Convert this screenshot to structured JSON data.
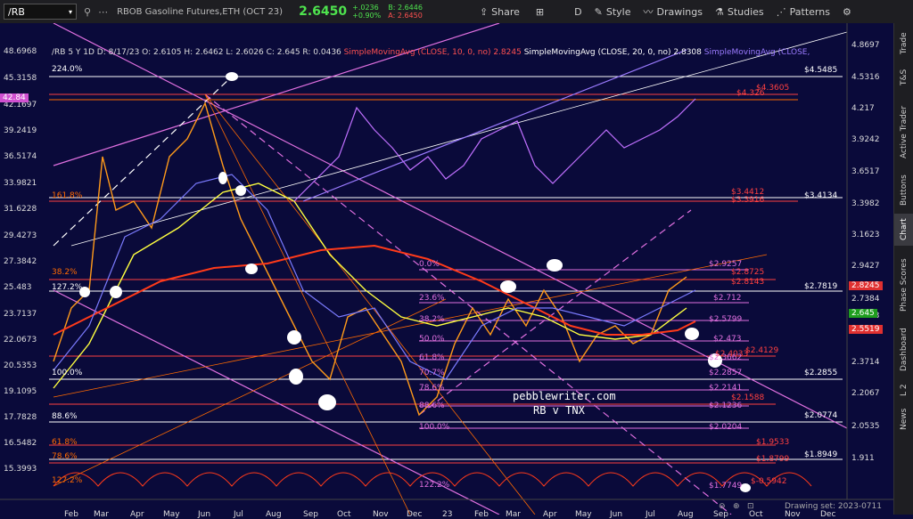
{
  "toolbar": {
    "symbol": "/RB",
    "instrument_name": "RBOB Gasoline Futures,ETH (OCT 23)",
    "last_price": "2.6450",
    "change_abs": "+.0236",
    "change_pct": "+0.90%",
    "bid": "B: 2.6446",
    "ask": "A: 2.6450",
    "buttons": {
      "share": "Share",
      "interval": "D",
      "style": "Style",
      "drawings": "Drawings",
      "studies": "Studies",
      "patterns": "Patterns"
    }
  },
  "sidebar": [
    "Trade",
    "T&S",
    "Active Trader",
    "Buttons",
    "Chart",
    "Phase Scores",
    "Dashboard",
    "L 2",
    "News"
  ],
  "infobar": {
    "summary": "/RB 5 Y 1D   D: 8/17/23   O: 2.6105   H: 2.6462   L: 2.6026   C: 2.645   R: 0.0436",
    "ma10": "SimpleMovingAvg (CLOSE, 10, 0, no)  2.8245",
    "ma20": "SimpleMovingAvg (CLOSE, 20, 0, no)  2.8308",
    "ma30": "SimpleMovingAvg (CLOSE,"
  },
  "left_axis": [
    "48.6968",
    "45.3158",
    "42.1697",
    "39.2419",
    "36.5174",
    "33.9821",
    "31.6228",
    "29.4273",
    "27.3842",
    "25.483",
    "23.7137",
    "22.0673",
    "20.5353",
    "19.1095",
    "17.7828",
    "16.5482",
    "15.3993"
  ],
  "left_tag": "42.84",
  "right_axis": [
    "4.8697",
    "4.5316",
    "4.217",
    "3.9242",
    "3.6517",
    "3.3982",
    "3.1623",
    "2.9427",
    "2.7384",
    "2.5483",
    "2.3714",
    "2.2067",
    "2.0535",
    "1.911"
  ],
  "right_tags": [
    {
      "value": "2.8245",
      "color": "#e03030"
    },
    {
      "value": "2.645",
      "color": "#1f9e1f"
    },
    {
      "value": "2.5519",
      "color": "#e03030"
    }
  ],
  "x_axis": [
    "Feb",
    "Mar",
    "Apr",
    "May",
    "Jun",
    "Jul",
    "Aug",
    "Sep",
    "Oct",
    "Nov",
    "Dec",
    "23",
    "Feb",
    "Mar",
    "Apr",
    "May",
    "Jun",
    "Jul",
    "Aug",
    "Sep",
    "Oct",
    "Nov",
    "Dec"
  ],
  "fib_labels": [
    {
      "text": "224.0%",
      "color": "#ffffff"
    },
    {
      "text": "$4.5485",
      "color": "#ffffff"
    },
    {
      "text": "$4.3605",
      "color": "#ff4040"
    },
    {
      "text": "$4.326",
      "color": "#ff4040"
    },
    {
      "text": "161.8%",
      "color": "#ff6a00"
    },
    {
      "text": "$3.4412",
      "color": "#ff4040"
    },
    {
      "text": "$3.3916",
      "color": "#ff4040"
    },
    {
      "text": "$3.4134",
      "color": "#ffffff"
    },
    {
      "text": "0.0%",
      "color": "#e070e0"
    },
    {
      "text": "$2.9257",
      "color": "#e070e0"
    },
    {
      "text": "$2.8725",
      "color": "#ff4040"
    },
    {
      "text": "$2.8143",
      "color": "#ff4040"
    },
    {
      "text": "$2.7819",
      "color": "#ffffff"
    },
    {
      "text": "38.2%",
      "color": "#ff6a00"
    },
    {
      "text": "127.2%",
      "color": "#ffffff"
    },
    {
      "text": "23.6%",
      "color": "#e070e0"
    },
    {
      "text": "$2.712",
      "color": "#e070e0"
    },
    {
      "text": "38.2%",
      "color": "#e070e0"
    },
    {
      "text": "$2.5799",
      "color": "#e070e0"
    },
    {
      "text": "50.0%",
      "color": "#e070e0"
    },
    {
      "text": "$2.473",
      "color": "#e070e0"
    },
    {
      "text": "$2.4129",
      "color": "#ff4040"
    },
    {
      "text": "$2.4033",
      "color": "#ff4040"
    },
    {
      "text": "61.8%",
      "color": "#e070e0"
    },
    {
      "text": "$2.3662",
      "color": "#e070e0"
    },
    {
      "text": "100.0%",
      "color": "#ffffff"
    },
    {
      "text": "$2.2855",
      "color": "#ffffff"
    },
    {
      "text": "$2.2857",
      "color": "#e070e0"
    },
    {
      "text": "70.7%",
      "color": "#e070e0"
    },
    {
      "text": "$2.2141",
      "color": "#e070e0"
    },
    {
      "text": "78.6%",
      "color": "#e070e0"
    },
    {
      "text": "$2.1588",
      "color": "#ff4040"
    },
    {
      "text": "88.6%",
      "color": "#e070e0"
    },
    {
      "text": "$2.1236",
      "color": "#e070e0"
    },
    {
      "text": "88.6%",
      "color": "#ffffff"
    },
    {
      "text": "$2.0774",
      "color": "#ffffff"
    },
    {
      "text": "100.0%",
      "color": "#e070e0"
    },
    {
      "text": "$2.0204",
      "color": "#e070e0"
    },
    {
      "text": "61.8%",
      "color": "#ff6a00"
    },
    {
      "text": "$1.9533",
      "color": "#ff4040"
    },
    {
      "text": "78.6%",
      "color": "#ff6a00"
    },
    {
      "text": "$1.8949",
      "color": "#ffffff"
    },
    {
      "text": "$1.8799",
      "color": "#ff4040"
    },
    {
      "text": "127.2%",
      "color": "#ff6a00"
    },
    {
      "text": "122.2%",
      "color": "#e070e0"
    },
    {
      "text": "$-0.5942",
      "color": "#ff4040"
    },
    {
      "text": "$1.7749",
      "color": "#e070e0"
    }
  ],
  "watermark": [
    "pebblewriter.com",
    "RB v TNX"
  ],
  "status": "Drawing set: 2023-0711"
}
